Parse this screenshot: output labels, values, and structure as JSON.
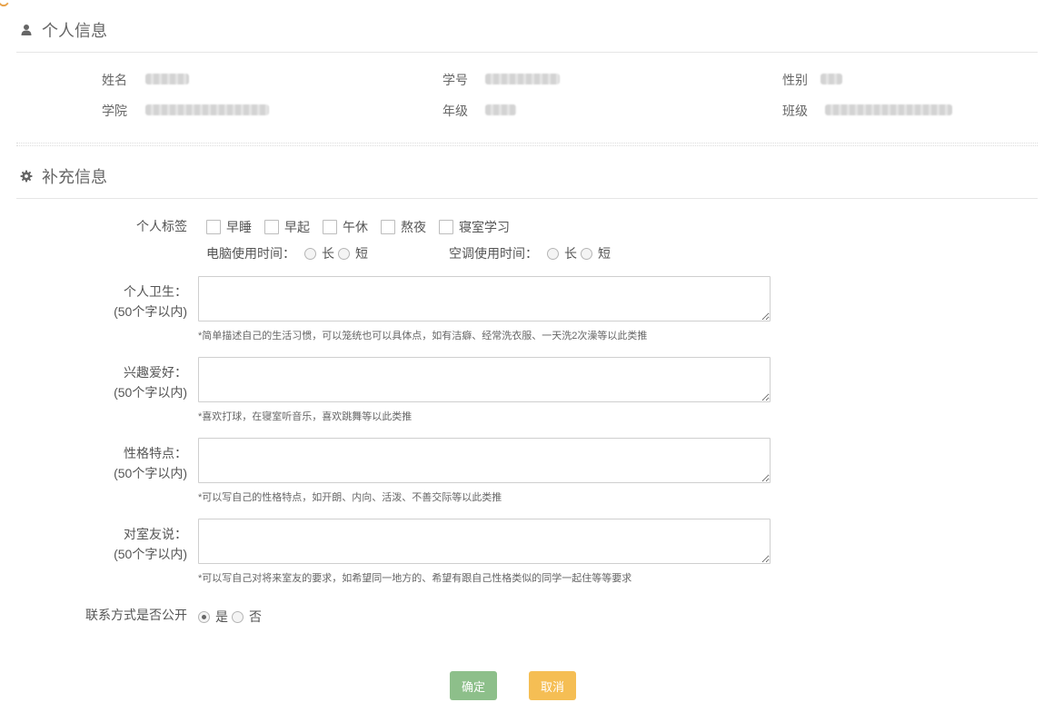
{
  "personal": {
    "title": "个人信息",
    "icon": "user-icon",
    "fields": [
      {
        "label": "姓名"
      },
      {
        "label": "学号"
      },
      {
        "label": "性别"
      },
      {
        "label": "学院"
      },
      {
        "label": "年级"
      },
      {
        "label": "班级"
      }
    ]
  },
  "extra": {
    "title": "补充信息",
    "icon": "gear-icon",
    "tags_label": "个人标签",
    "tags": [
      "早睡",
      "早起",
      "午休",
      "熬夜",
      "寝室学习"
    ],
    "computer_label": "电脑使用时间：",
    "ac_label": "空调使用时间：",
    "long": "长",
    "short": "短",
    "hygiene_label": "个人卫生：",
    "hygiene_limit": "(50个字以内)",
    "hygiene_hint": "*简单描述自己的生活习惯，可以笼统也可以具体点，如有洁癖、经常洗衣服、一天洗2次澡等以此类推",
    "hobby_label": "兴趣爱好：",
    "hobby_limit": "(50个字以内)",
    "hobby_hint": "*喜欢打球，在寝室听音乐，喜欢跳舞等以此类推",
    "personality_label": "性格特点：",
    "personality_limit": "(50个字以内)",
    "personality_hint": "*可以写自己的性格特点，如开朗、内向、活泼、不善交际等以此类推",
    "roommate_label": "对室友说：",
    "roommate_limit": "(50个字以内)",
    "roommate_hint": "*可以写自己对将来室友的要求，如希望同一地方的、希望有跟自己性格类似的同学一起住等等要求",
    "contact_label": "联系方式是否公开",
    "yes": "是",
    "no": "否"
  },
  "buttons": {
    "ok": "确定",
    "cancel": "取消"
  },
  "colors": {
    "ok": "#8dbf8a",
    "cancel": "#f5be54",
    "accent_corner": "#e8a24a"
  }
}
